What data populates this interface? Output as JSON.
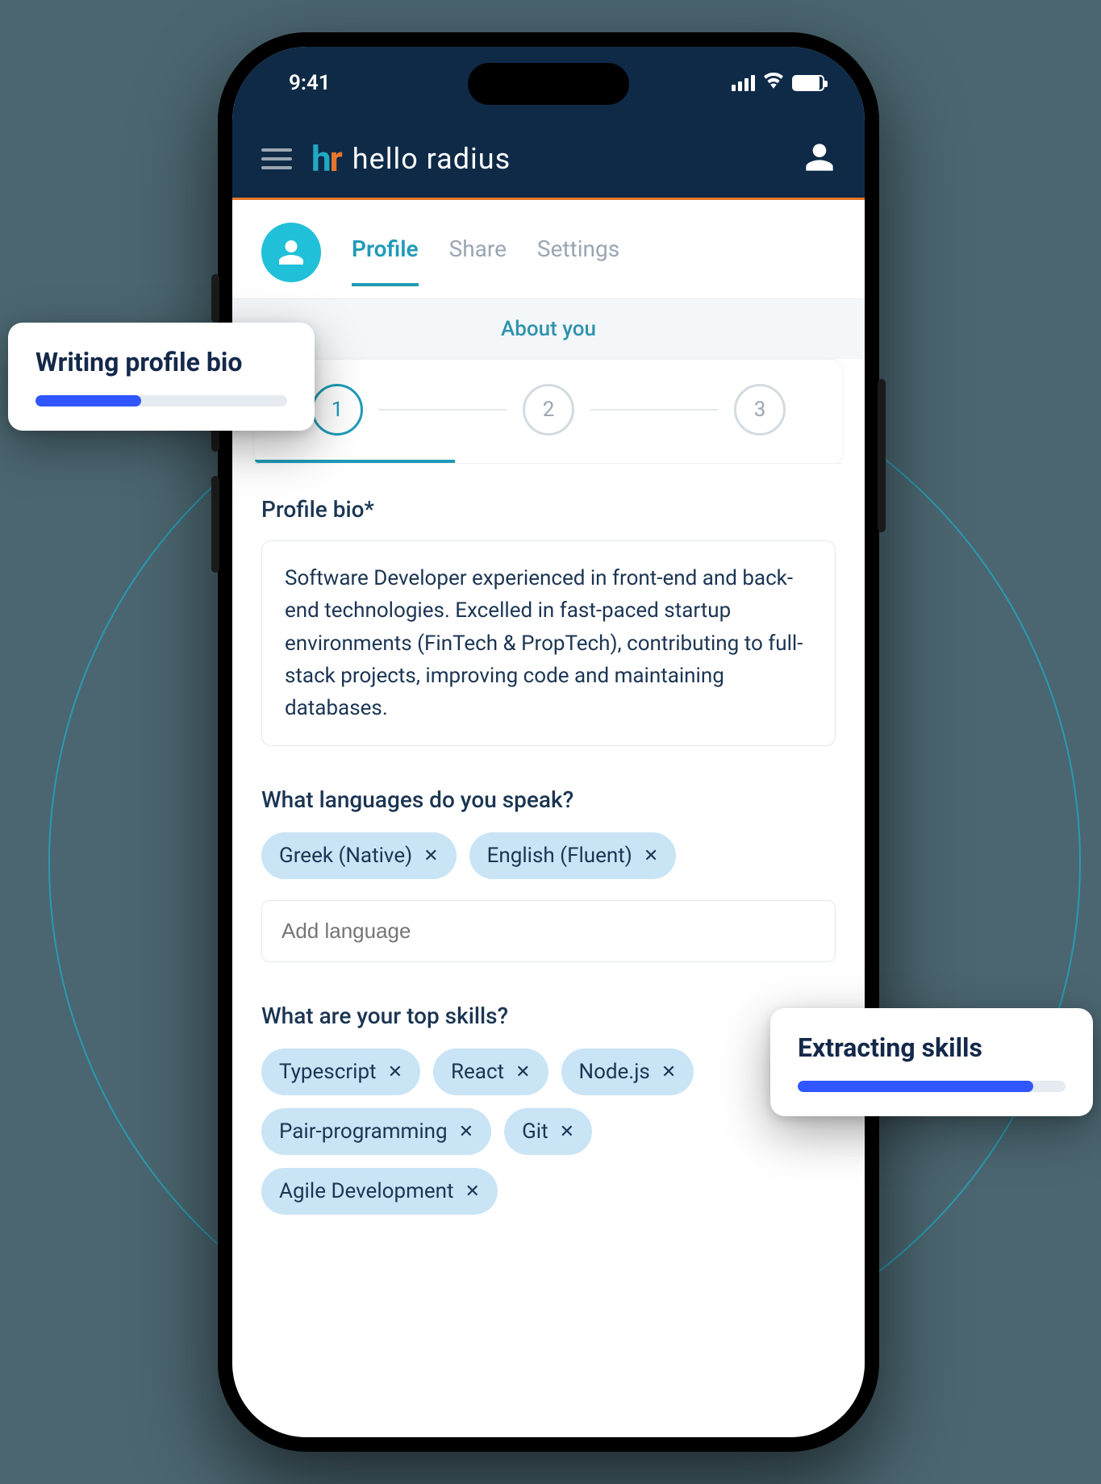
{
  "status": {
    "time": "9:41"
  },
  "header": {
    "brand_text": "hello radius"
  },
  "tabs": {
    "items": [
      {
        "label": "Profile",
        "active": true
      },
      {
        "label": "Share",
        "active": false
      },
      {
        "label": "Settings",
        "active": false
      }
    ]
  },
  "section_title": "About you",
  "stepper": {
    "steps": [
      "1",
      "2",
      "3"
    ],
    "active_index": 0
  },
  "form": {
    "bio_label": "Profile bio*",
    "bio_value": "Software Developer experienced in front-end and back-end technologies. Excelled in fast-paced startup environments (FinTech & PropTech), contributing to full-stack projects, improving code and maintaining databases.",
    "languages_label": "What languages do you speak?",
    "languages": [
      "Greek (Native)",
      "English (Fluent)"
    ],
    "add_language_placeholder": "Add language",
    "skills_label": "What are your top skills?",
    "skills": [
      "Typescript",
      "React",
      "Node.js",
      "Pair-programming",
      "Git",
      "Agile Development"
    ]
  },
  "popups": {
    "writing": {
      "title": "Writing profile bio",
      "progress": 42
    },
    "extracting": {
      "title": "Extracting skills",
      "progress": 88
    }
  },
  "colors": {
    "brand_navy": "#0e2a47",
    "brand_orange": "#e8762c",
    "brand_teal": "#21a8c3",
    "chip_bg": "#c9e4f5",
    "progress": "#2f56ff"
  }
}
